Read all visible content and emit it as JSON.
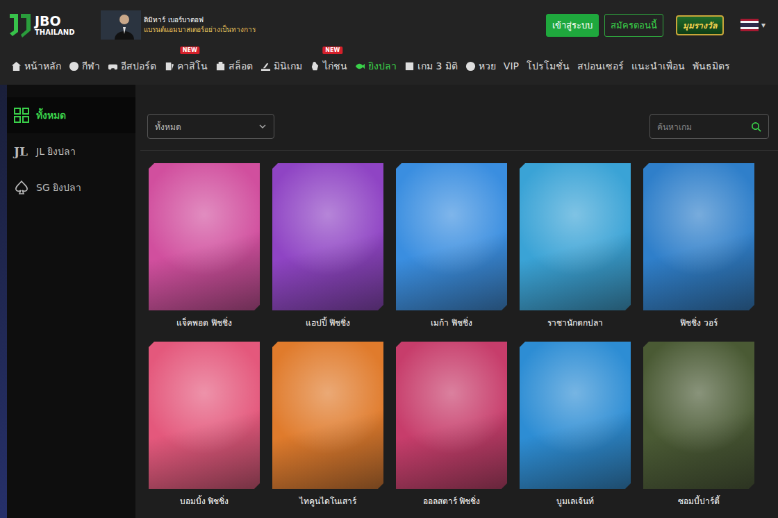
{
  "header": {
    "logo": {
      "brand": "JBO",
      "region": "THAILAND"
    },
    "ambassador": {
      "name": "ดิมิทาร์ เบอร์บาตอฟ",
      "role": "แบรนด์แอมบาสเดอร์อย่างเป็นทางการ"
    },
    "login": "เข้าสู่ระบบ",
    "signup": "สมัครตอนนี้",
    "rewards": "มุมรางวัล",
    "language_caret": "▾"
  },
  "nav": [
    {
      "label": "หน้าหลัก",
      "selected": false
    },
    {
      "label": "กีฬา",
      "selected": false
    },
    {
      "label": "อีสปอร์ต",
      "selected": false
    },
    {
      "label": "คาสิโน",
      "badge": "NEW",
      "selected": false
    },
    {
      "label": "สล็อต",
      "selected": false
    },
    {
      "label": "มินิเกม",
      "selected": false
    },
    {
      "label": "ไก่ชน",
      "badge": "NEW",
      "selected": false
    },
    {
      "label": "ยิงปลา",
      "selected": true
    },
    {
      "label": "เกม 3 มิติ",
      "selected": false
    },
    {
      "label": "หวย",
      "selected": false
    },
    {
      "label": "VIP",
      "selected": false
    },
    {
      "label": "โปรโมชั่น",
      "selected": false
    },
    {
      "label": "สปอนเซอร์",
      "selected": false
    },
    {
      "label": "แนะนำเพื่อน",
      "selected": false
    },
    {
      "label": "พันธมิตร",
      "selected": false
    }
  ],
  "sidebar": {
    "items": [
      {
        "label": "ทั้งหมด",
        "selected": true
      },
      {
        "label": "JL ยิงปลา",
        "mark": "JL",
        "selected": false
      },
      {
        "label": "SG ยิงปลา",
        "selected": false
      }
    ]
  },
  "filter": {
    "value": "ทั้งหมด"
  },
  "search": {
    "placeholder": "ค้นหาเกม"
  },
  "games": [
    {
      "title": "แจ็คพอต ฟิชชิ่ง",
      "color": "#d14f9e"
    },
    {
      "title": "แฮปปี้ ฟิชชิ่ง",
      "color": "#8f44c4"
    },
    {
      "title": "เมก้า ฟิชชิ่ง",
      "color": "#3a8ee0"
    },
    {
      "title": "ราชานักตกปลา",
      "color": "#3aa3d6"
    },
    {
      "title": "ฟิชชิ่ง วอร์",
      "color": "#2f7fca"
    },
    {
      "title": "บอมบิ้ง ฟิชชิ่ง",
      "color": "#e4587c"
    },
    {
      "title": "ไทคูนไดโนเสาร์",
      "color": "#e07b2c"
    },
    {
      "title": "ออลสตาร์ ฟิชชิ่ง",
      "color": "#c73d6b"
    },
    {
      "title": "บูมเลเจ้นท์",
      "color": "#2d8dd4"
    },
    {
      "title": "ซอมบี้ปาร์ตี้",
      "color": "#4a5a34"
    }
  ]
}
